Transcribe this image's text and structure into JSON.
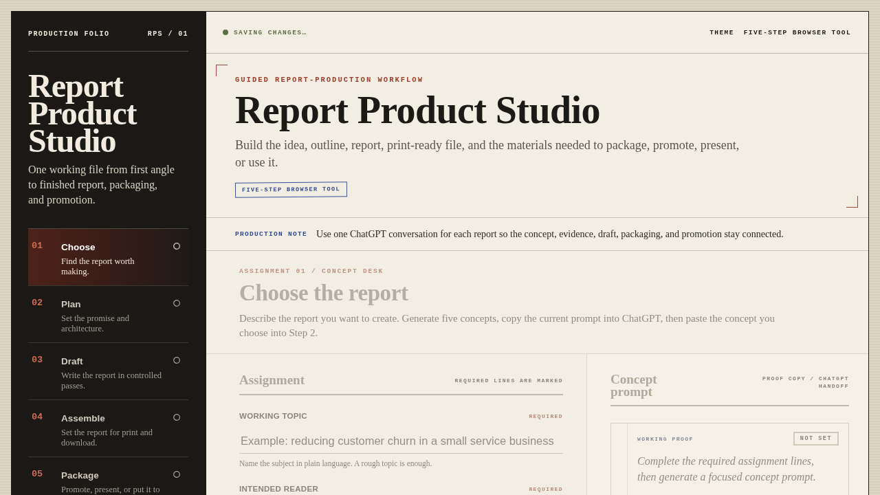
{
  "sidebar": {
    "kicker": "PRODUCTION FOLIO",
    "code": "RPS / 01",
    "title": "Report Product Studio",
    "subtitle": "One working file from first angle to finished report, packaging, and promotion.",
    "steps": [
      {
        "number": "01",
        "title": "Choose",
        "description": "Find the report worth making.",
        "selected": true
      },
      {
        "number": "02",
        "title": "Plan",
        "description": "Set the promise and architecture.",
        "selected": false
      },
      {
        "number": "03",
        "title": "Draft",
        "description": "Write the report in controlled passes.",
        "selected": false
      },
      {
        "number": "04",
        "title": "Assemble",
        "description": "Set the report for print and download.",
        "selected": false
      },
      {
        "number": "05",
        "title": "Package",
        "description": "Promote, present, or put it to",
        "selected": false
      }
    ]
  },
  "top_bar": {
    "status": "SAVING CHANGES…",
    "theme_button": "THEME",
    "tool_label": "FIVE-STEP BROWSER TOOL"
  },
  "hero": {
    "eyebrow": "GUIDED REPORT-PRODUCTION WORKFLOW",
    "title": "Report Product Studio",
    "description": "Build the idea, outline, report, print-ready file, and the materials needed to package, promote, present, or use it.",
    "badge": "FIVE-STEP BROWSER TOOL"
  },
  "note": {
    "label": "PRODUCTION NOTE",
    "text": "Use one ChatGPT conversation for each report so the concept, evidence, draft, packaging, and promotion stay connected."
  },
  "assignment_intro": {
    "eyebrow": "ASSIGNMENT 01 / CONCEPT DESK",
    "title": "Choose the report",
    "description": "Describe the report you want to create. Generate five concepts, copy the current prompt into ChatGPT, then paste the concept you choose into Step 2."
  },
  "assignment_panel": {
    "title": "Assignment",
    "note": "REQUIRED LINES ARE MARKED",
    "fields": [
      {
        "label": "WORKING TOPIC",
        "tag": "REQUIRED",
        "placeholder": "Example: reducing customer churn in a small service business",
        "hint": "Name the subject in plain language. A rough topic is enough."
      },
      {
        "label": "INTENDED READER",
        "tag": "REQUIRED"
      }
    ]
  },
  "prompt_panel": {
    "title": "Concept prompt",
    "note": "PROOF COPY / CHATGPT HANDOFF",
    "proof": {
      "label": "WORKING PROOF",
      "status": "NOT SET",
      "text": "Complete the required assignment lines, then generate a focused concept prompt."
    }
  }
}
